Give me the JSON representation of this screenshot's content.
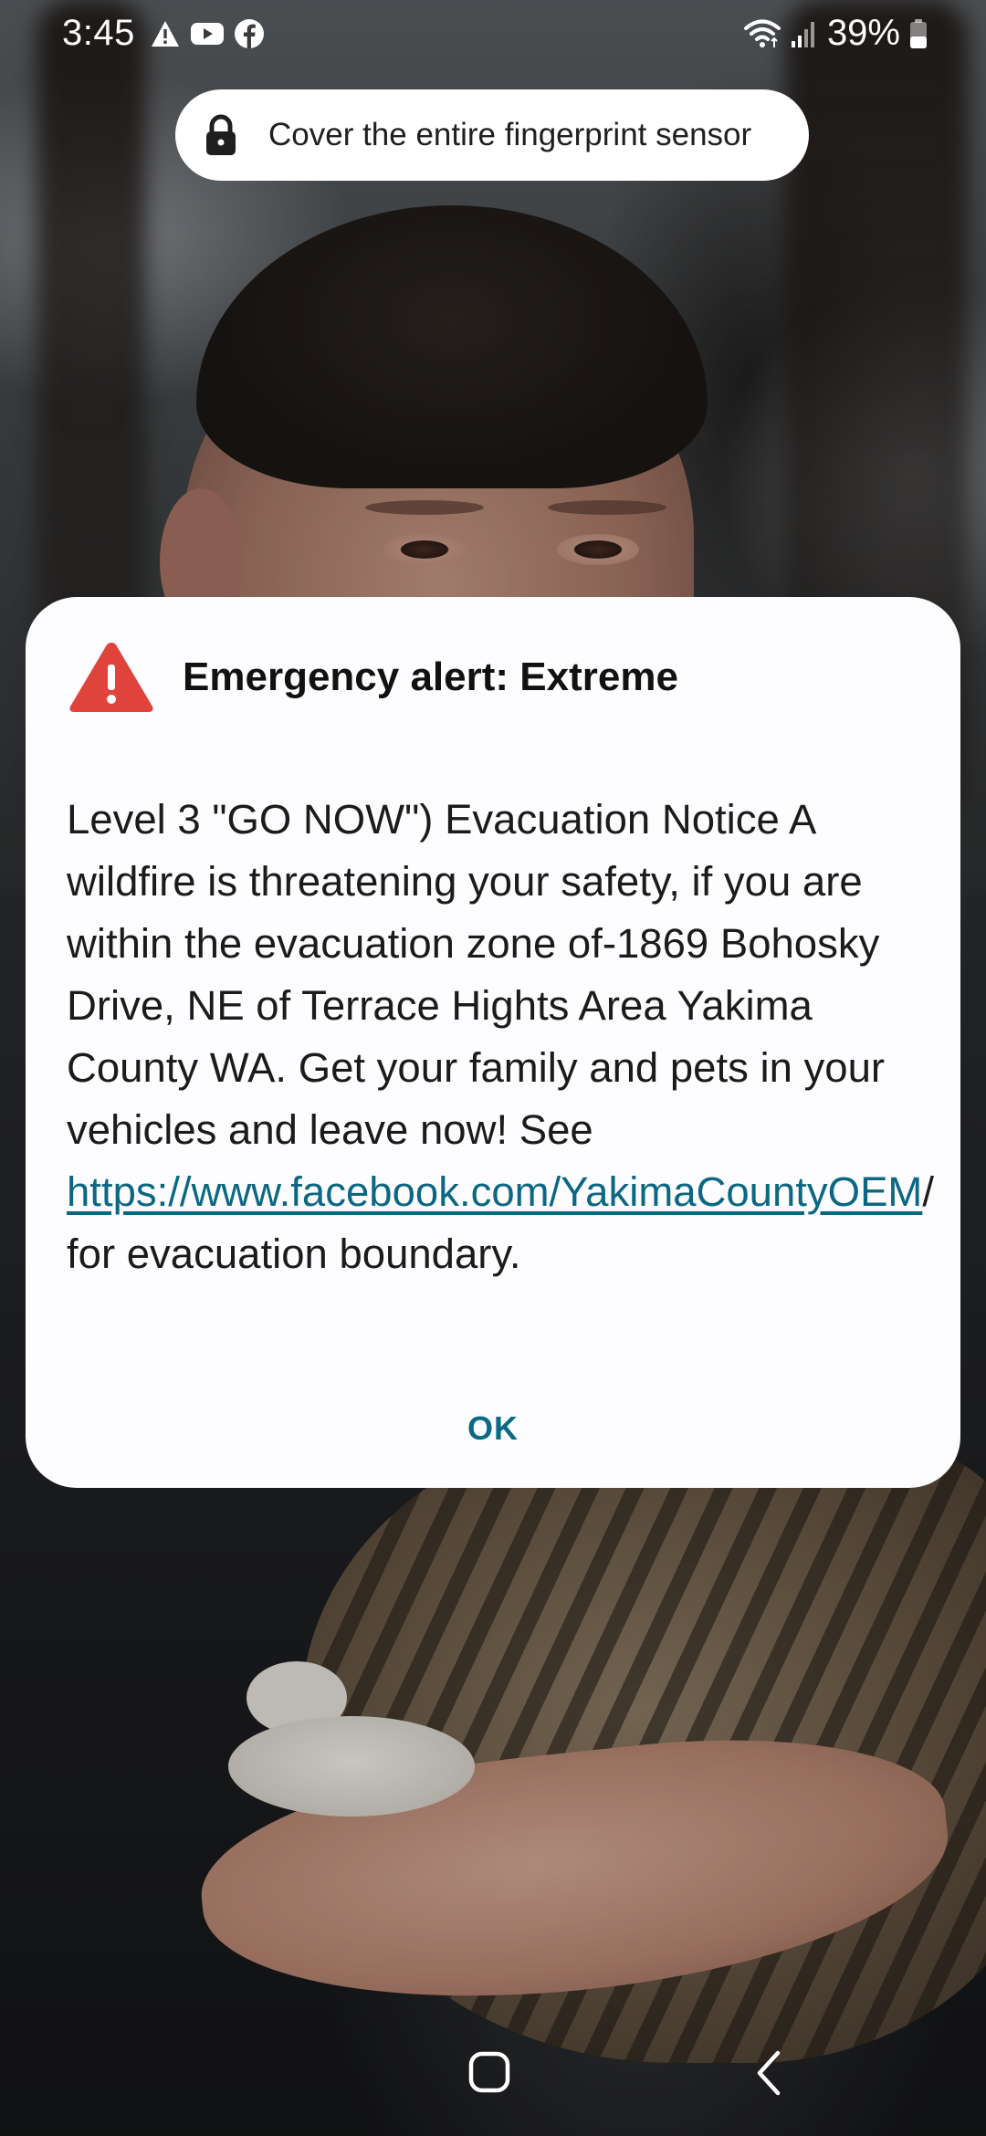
{
  "status_bar": {
    "time": "3:45",
    "notification_icons": [
      "warning-icon",
      "youtube-icon",
      "facebook-icon"
    ],
    "battery_percent": "39%",
    "wifi_icon": "wifi-icon",
    "signal_icon": "signal-icon",
    "battery_icon": "battery-icon"
  },
  "lockscreen": {
    "fingerprint_hint": "Cover the entire fingerprint sensor",
    "hint_icon": "lock-icon"
  },
  "alert": {
    "icon": "warning-triangle-icon",
    "title": "Emergency alert: Extreme",
    "message_before_link": "Level 3 \"GO NOW\") Evacuation Notice A wildfire is threatening your safety, if you are within the evacuation zone of-1869 Bohosky Drive, NE of Terrace Hights Area Yakima County WA. Get your family and pets in your vehicles and leave now! See ",
    "link_text": "https://www.facebook.com/YakimaCountyOEM",
    "message_after_link": "/ for evacuation boundary.",
    "ok_label": "OK"
  },
  "colors": {
    "alert_red": "#e0433b",
    "link": "#0b6782",
    "ok_button": "#0a6a85",
    "dialog_background": "#fdfdff"
  },
  "nav_bar": {
    "home_icon": "home-icon",
    "back_icon": "back-icon"
  }
}
